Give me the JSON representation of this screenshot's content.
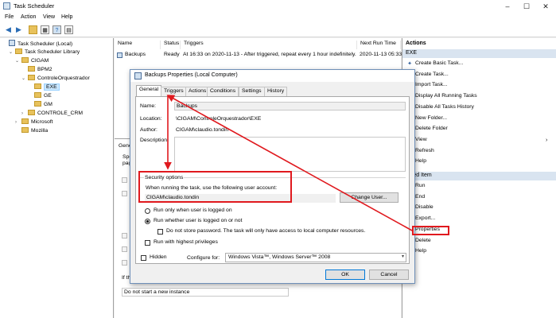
{
  "window": {
    "title": "Task Scheduler"
  },
  "menu": [
    "File",
    "Action",
    "View",
    "Help"
  ],
  "tree": [
    {
      "label": "Task Scheduler (Local)",
      "level": 0,
      "expander": "",
      "icon": "scheduler"
    },
    {
      "label": "Task Scheduler Library",
      "level": 1,
      "expander": "⌄",
      "icon": "folder"
    },
    {
      "label": "CIGAM",
      "level": 2,
      "expander": "⌄",
      "icon": "folder"
    },
    {
      "label": "BPM2",
      "level": 3,
      "expander": "",
      "icon": "folder"
    },
    {
      "label": "ControleOrquestrador",
      "level": 3,
      "expander": "⌄",
      "icon": "folder"
    },
    {
      "label": "EXE",
      "level": 4,
      "expander": "",
      "icon": "folder",
      "selected": true
    },
    {
      "label": "GE",
      "level": 4,
      "expander": "",
      "icon": "folder"
    },
    {
      "label": "GM",
      "level": 4,
      "expander": "",
      "icon": "folder"
    },
    {
      "label": "CONTROLE_CRM",
      "level": 3,
      "expander": "›",
      "icon": "folder"
    },
    {
      "label": "Microsoft",
      "level": 2,
      "expander": "›",
      "icon": "folder"
    },
    {
      "label": "Mozilla",
      "level": 2,
      "expander": "",
      "icon": "folder"
    }
  ],
  "tasklist": {
    "columns": {
      "name": "Name",
      "status": "Status",
      "triggers": "Triggers",
      "next_run": "Next Run Time"
    },
    "row": {
      "name": "Backups",
      "status": "Ready",
      "triggers": "At 16:33 on 2020-11-13 - After triggered, repeat every 1 hour indefinitely.",
      "next_run": "2020-11-13 05:33"
    }
  },
  "lower_panel": {
    "tab_fragment": "Gene",
    "spec_fragment": "Spe",
    "pag_fragment": "pag",
    "if_fragment": "If th",
    "instance_rule": "Do not start a new instance"
  },
  "actions": {
    "header": "Actions",
    "section1": "EXE",
    "items1": [
      {
        "label": "Create Basic Task...",
        "icon": "wand-icon"
      },
      {
        "label": "Create Task...",
        "icon": "task-icon"
      },
      {
        "label": "Import Task...",
        "icon": "import-icon"
      },
      {
        "label": "Display All Running Tasks",
        "icon": "list-icon"
      },
      {
        "label": "Disable All Tasks History",
        "icon": "history-icon"
      },
      {
        "label": "New Folder...",
        "icon": "folder-icon"
      },
      {
        "label": "Delete Folder",
        "icon": "delete-icon"
      },
      {
        "label": "View",
        "icon": ""
      },
      {
        "label": "Refresh",
        "icon": "refresh-icon"
      },
      {
        "label": "Help",
        "icon": "help-icon"
      }
    ],
    "section2": "ected Item",
    "items2": [
      {
        "label": "Run",
        "icon": "run-icon"
      },
      {
        "label": "End",
        "icon": "end-icon"
      },
      {
        "label": "Disable",
        "icon": "disable-icon"
      },
      {
        "label": "Export...",
        "icon": "export-icon"
      },
      {
        "label": "Properties",
        "icon": "properties-icon"
      },
      {
        "label": "Delete",
        "icon": "delete-icon"
      },
      {
        "label": "Help",
        "icon": "help-icon"
      }
    ]
  },
  "dialog": {
    "title": "Backups Properties (Local Computer)",
    "tabs": [
      "General",
      "Triggers",
      "Actions",
      "Conditions",
      "Settings",
      "History"
    ],
    "name_label": "Name:",
    "name_value": "Backups",
    "location_label": "Location:",
    "location_value": "\\CIGAM\\ControleOrquestrador\\EXE",
    "author_label": "Author:",
    "author_value": "CIGAM\\claudio.tondin",
    "description_label": "Description:",
    "description_value": "",
    "security_header": "Security options",
    "run_as_text": "When running the task, use the following user account:",
    "run_as_user": "CIGAM\\claudio.tondin",
    "change_user_button": "Change User...",
    "radio_logged_on": "Run only when user is logged on",
    "radio_logged_on_or_not": "Run whether user is logged on or not",
    "store_password": "Do not store password.  The task will only have access to local computer resources.",
    "highest_privileges": "Run with highest privileges",
    "hidden": "Hidden",
    "configure_for_label": "Configure for:",
    "configure_for_value": "Windows Vista™, Windows Server™ 2008",
    "ok_button": "OK",
    "cancel_button": "Cancel"
  },
  "annotation_color": "#e0191e"
}
